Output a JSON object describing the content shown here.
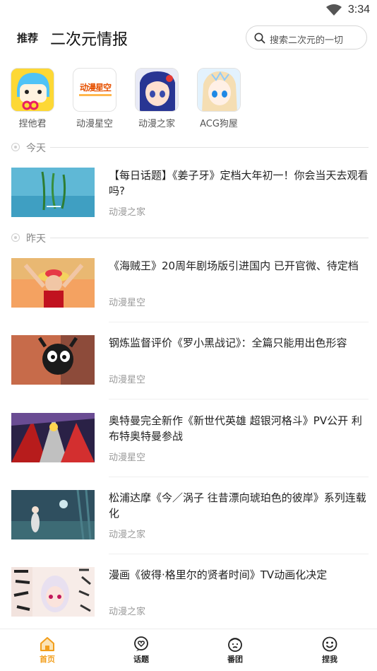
{
  "status_bar": {
    "time": "3:34"
  },
  "header": {
    "tab_recommend": "推荐",
    "tab_news": "二次元情报",
    "search_placeholder": "搜索二次元的一切"
  },
  "sources": [
    {
      "name": "捏他君"
    },
    {
      "name": "动漫星空",
      "logo_text": "动漫星空"
    },
    {
      "name": "动漫之家"
    },
    {
      "name": "ACG狗屋"
    }
  ],
  "sections": [
    {
      "label": "今天",
      "items": [
        {
          "title": "【每日话题】《姜子牙》定档大年初一！你会当天去观看吗?",
          "source": "动漫之家"
        }
      ]
    },
    {
      "label": "昨天",
      "items": [
        {
          "title": "《海贼王》20周年剧场版引进国内 已开官微、待定档",
          "source": "动漫星空"
        },
        {
          "title": "钢炼监督评价《罗小黑战记》：全篇只能用出色形容",
          "source": "动漫星空"
        },
        {
          "title": "奥特曼完全新作《新世代英雄 超银河格斗》PV公开 利布特奥特曼参战",
          "source": "动漫星空"
        },
        {
          "title": "松浦达摩《今／涡子 往昔漂向琥珀色的彼岸》系列连载化",
          "source": "动漫之家"
        },
        {
          "title": "漫画《彼得·格里尔的贤者时间》TV动画化决定",
          "source": "动漫之家"
        }
      ]
    }
  ],
  "bottom_nav": [
    {
      "label": "首页",
      "icon": "home-icon",
      "active": true
    },
    {
      "label": "话题",
      "icon": "heart-bubble-icon",
      "active": false
    },
    {
      "label": "番团",
      "icon": "face-icon",
      "active": false
    },
    {
      "label": "捏我",
      "icon": "smile-icon",
      "active": false
    }
  ],
  "colors": {
    "accent": "#f29e1b",
    "text": "#222222",
    "muted": "#999999"
  }
}
